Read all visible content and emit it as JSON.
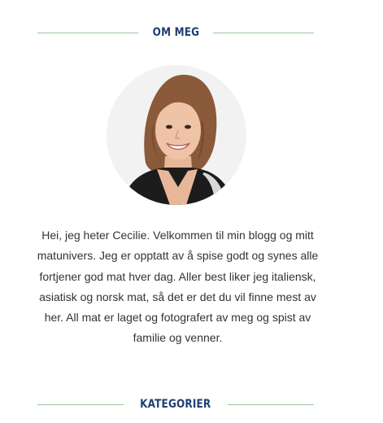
{
  "about": {
    "heading": "OM MEG",
    "bio": "Hei, jeg heter Cecilie. Velkommen til min blogg og mitt matunivers. Jeg er opptatt av å spise godt og synes alle fortjener god mat hver dag. Aller best liker jeg italiensk, asiatisk og norsk mat, så det er det du vil finne mest av her. All mat er laget og fotografert av meg og spist av familie og venner."
  },
  "categories": {
    "heading": "KATEGORIER"
  },
  "colors": {
    "heading_text": "#1f3f73",
    "rule": "#9cc49a",
    "body_text": "#333333"
  }
}
